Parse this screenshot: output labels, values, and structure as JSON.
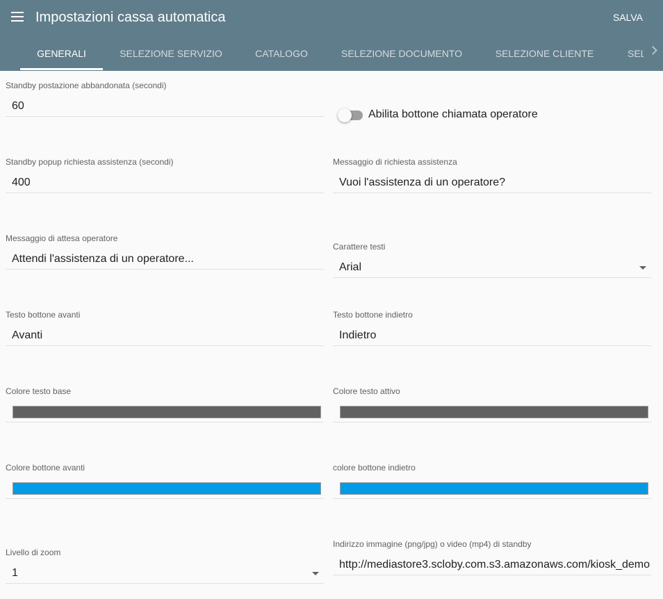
{
  "header": {
    "title": "Impostazioni cassa automatica",
    "save_label": "SALVA"
  },
  "tabs": [
    {
      "label": "GENERALI",
      "active": true
    },
    {
      "label": "SELEZIONE SERVIZIO",
      "active": false
    },
    {
      "label": "CATALOGO",
      "active": false
    },
    {
      "label": "SELEZIONE DOCUMENTO",
      "active": false
    },
    {
      "label": "SELEZIONE CLIENTE",
      "active": false
    },
    {
      "label": "SEL",
      "active": false
    }
  ],
  "form": {
    "standby_postazione": {
      "label": "Standby postazione abbandonata (secondi)",
      "value": "60"
    },
    "operator_button": {
      "label": "Abilita bottone chiamata operatore",
      "enabled": false
    },
    "standby_popup": {
      "label": "Standby popup richiesta assistenza (secondi)",
      "value": "400"
    },
    "messaggio_richiesta": {
      "label": "Messaggio di richiesta assistenza",
      "value": "Vuoi l'assistenza di un operatore?"
    },
    "messaggio_attesa": {
      "label": "Messaggio di attesa operatore",
      "value": "Attendi l'assistenza di un operatore..."
    },
    "carattere_testi": {
      "label": "Carattere testi",
      "value": "Arial"
    },
    "testo_avanti": {
      "label": "Testo bottone avanti",
      "value": "Avanti"
    },
    "testo_indietro": {
      "label": "Testo bottone indietro",
      "value": "Indietro"
    },
    "colore_testo_base": {
      "label": "Colore testo base",
      "color": "#616161"
    },
    "colore_testo_attivo": {
      "label": "Colore testo attivo",
      "color": "#616161"
    },
    "colore_bottone_avanti": {
      "label": "Colore bottone avanti",
      "color": "#039be5"
    },
    "colore_bottone_indietro": {
      "label": "colore bottone indietro",
      "color": "#039be5"
    },
    "livello_zoom": {
      "label": "Livello di zoom",
      "value": "1"
    },
    "indirizzo_standby": {
      "label": "Indirizzo immagine (png/jpg) o video (mp4) di standby",
      "value": "http://mediastore3.scloby.com.s3.amazonaws.com/kiosk_demo"
    }
  },
  "colors": {
    "appbar": "#607d8b",
    "accent": "#039be5"
  }
}
